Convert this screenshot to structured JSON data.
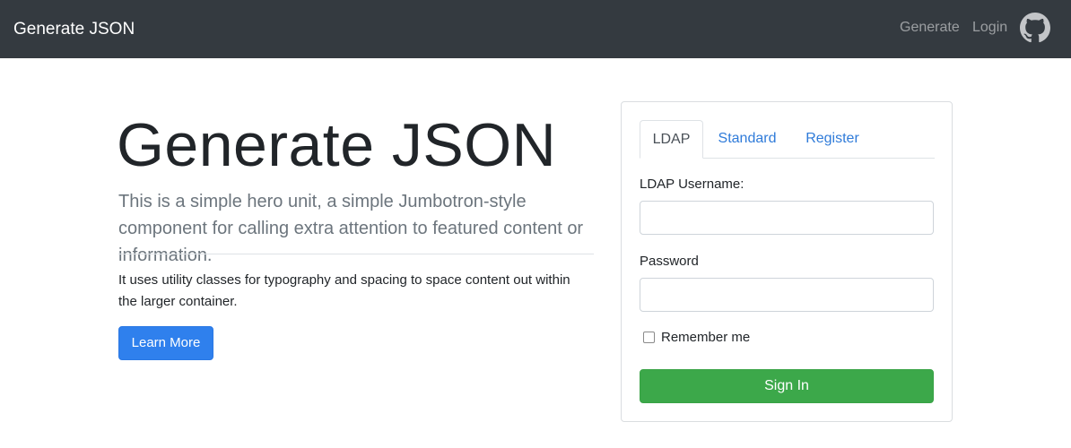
{
  "navbar": {
    "brand": "Generate JSON",
    "links": [
      {
        "label": "Generate"
      },
      {
        "label": "Login"
      }
    ],
    "github_icon": "github-icon"
  },
  "hero": {
    "title": "Generate JSON",
    "lead": "This is a simple hero unit, a simple Jumbotron-style component for calling extra attention to featured content or information.",
    "text": "It uses utility classes for typography and spacing to space content out within the larger container.",
    "button_label": "Learn More"
  },
  "login_card": {
    "tabs": [
      {
        "label": "LDAP",
        "active": true
      },
      {
        "label": "Standard",
        "active": false
      },
      {
        "label": "Register",
        "active": false
      }
    ],
    "username_label": "LDAP Username:",
    "username_value": "",
    "password_label": "Password",
    "password_value": "",
    "remember_label": "Remember me",
    "remember_checked": false,
    "signin_label": "Sign In"
  },
  "colors": {
    "navbar_bg": "#343a40",
    "primary": "#2f80ed",
    "success": "#3ca84a",
    "link": "#2f7bd9"
  }
}
